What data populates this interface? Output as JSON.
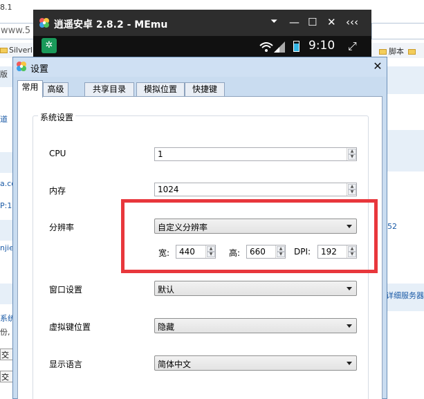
{
  "background_browser": {
    "title_fragment": "8.1",
    "address_fragment": "www.5",
    "bookmark_left": "Silverli",
    "bookmark_right": "脚本",
    "left_fragments": [
      "版",
      "道",
      "a.co",
      "P:1",
      "njie",
      "系统",
      "份,",
      "交",
      "交"
    ],
    "right_fragments": [
      "52",
      "详细服务器"
    ]
  },
  "emulator": {
    "title": "逍遥安卓 2.8.2 - MEmu",
    "time": "9:10",
    "controls": [
      "⏷",
      "—",
      "☐",
      "✕",
      "‹‹‹"
    ]
  },
  "dialog": {
    "title": "设置",
    "tabs": [
      "常用",
      "高级",
      "共享目录",
      "模拟位置",
      "快捷键"
    ],
    "active_tab": "常用",
    "group_title": "系统设置",
    "cpu": {
      "label": "CPU",
      "value": "1"
    },
    "memory": {
      "label": "内存",
      "value": "1024"
    },
    "resolution": {
      "label": "分辨率",
      "value": "自定义分辨率",
      "width_label": "宽:",
      "width_value": "440",
      "height_label": "高:",
      "height_value": "660",
      "dpi_label": "DPI:",
      "dpi_value": "192"
    },
    "window": {
      "label": "窗口设置",
      "value": "默认"
    },
    "virtual_keys": {
      "label": "虚拟键位置",
      "value": "隐藏"
    },
    "language": {
      "label": "显示语言",
      "value": "简体中文"
    }
  },
  "colors": {
    "highlight": "#e8373c",
    "dialog_chrome": "#c9dcf0",
    "emulator_bar": "#2d2d2d"
  }
}
